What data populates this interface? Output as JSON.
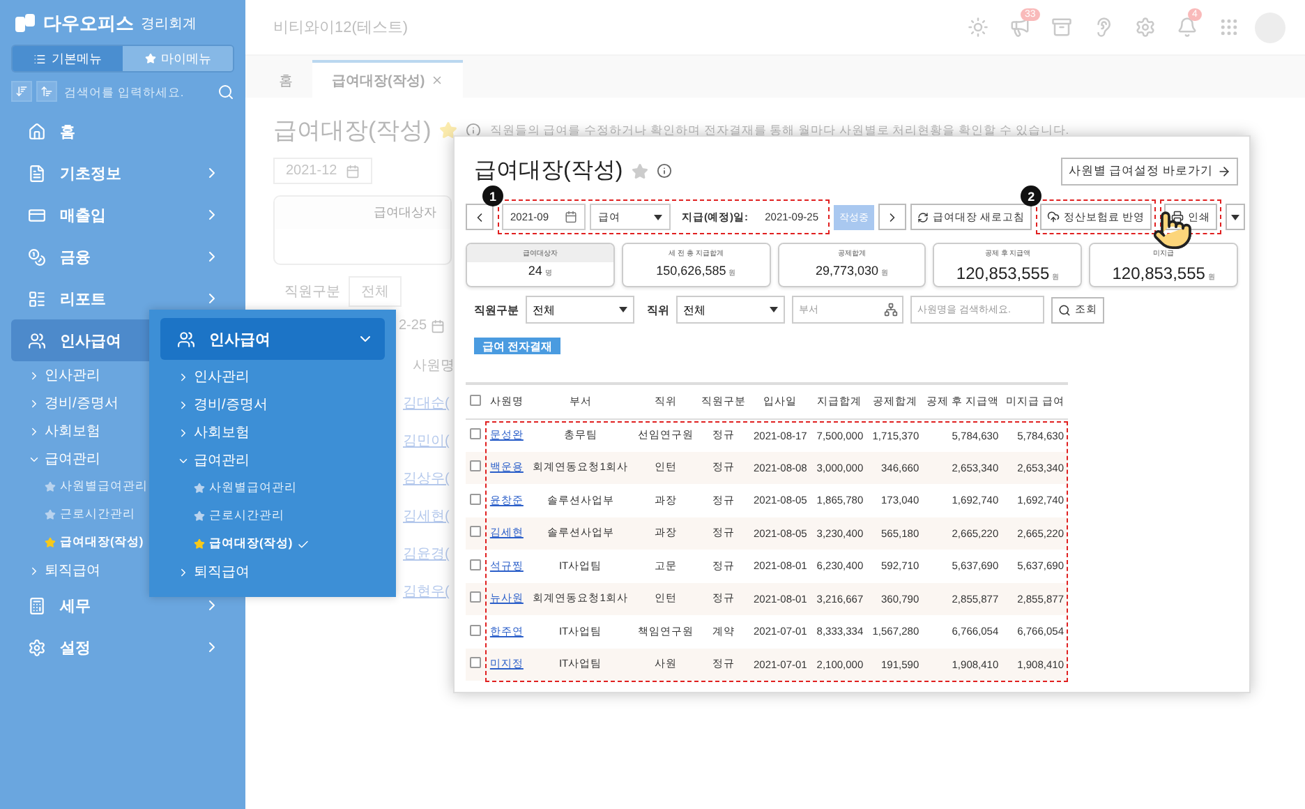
{
  "sidebar": {
    "brand": "다우오피스",
    "brand_sub": "경리회계",
    "menu_toggle": [
      {
        "label": "기본메뉴",
        "selected": true
      },
      {
        "label": "마이메뉴",
        "selected": false
      }
    ],
    "search": {
      "placeholder": "검색어를 입력하세요."
    },
    "items": [
      {
        "label": "홈",
        "has_submenu": false,
        "selected": false
      },
      {
        "label": "기초정보",
        "has_submenu": true,
        "selected": false,
        "expanded": false
      },
      {
        "label": "매출입",
        "has_submenu": true,
        "selected": false,
        "expanded": false
      },
      {
        "label": "금융",
        "has_submenu": true,
        "selected": false,
        "expanded": false
      },
      {
        "label": "리포트",
        "has_submenu": true,
        "selected": false,
        "expanded": false
      },
      {
        "label": "인사급여",
        "has_submenu": true,
        "selected": true,
        "expanded": true,
        "children": [
          {
            "label": "인사관리",
            "expanded": false
          },
          {
            "label": "경비/증명서",
            "expanded": false
          },
          {
            "label": "사회보험",
            "expanded": false
          },
          {
            "label": "급여관리",
            "expanded": true,
            "children": [
              {
                "label": "사원별급여관리",
                "selected": false
              },
              {
                "label": "근로시간관리",
                "selected": false
              },
              {
                "label": "급여대장(작성)",
                "selected": true
              }
            ]
          },
          {
            "label": "퇴직급여",
            "expanded": false
          }
        ]
      },
      {
        "label": "세무",
        "has_submenu": true,
        "selected": false,
        "expanded": false
      },
      {
        "label": "설정",
        "has_submenu": true,
        "selected": false,
        "expanded": false
      }
    ]
  },
  "popup_menu": {
    "title": "인사급여",
    "expanded": true,
    "children": [
      {
        "label": "인사관리",
        "expanded": false
      },
      {
        "label": "경비/증명서",
        "expanded": false
      },
      {
        "label": "사회보험",
        "expanded": false
      },
      {
        "label": "급여관리",
        "expanded": true,
        "children": [
          {
            "label": "사원별급여관리",
            "selected": false
          },
          {
            "label": "근로시간관리",
            "selected": false
          },
          {
            "label": "급여대장(작성)",
            "selected": true
          }
        ]
      },
      {
        "label": "퇴직급여",
        "expanded": false
      }
    ]
  },
  "topbar": {
    "company": "비티와이12(테스트)",
    "icons": [
      {
        "kind": "sun"
      },
      {
        "kind": "megaphone",
        "badge": "33"
      },
      {
        "kind": "drawer"
      },
      {
        "kind": "ear"
      },
      {
        "kind": "gear"
      },
      {
        "kind": "bell",
        "badge": "4"
      },
      {
        "kind": "apps"
      },
      {
        "kind": "avatar"
      }
    ]
  },
  "tabs": [
    {
      "label": "홈",
      "selected": false,
      "closable": false
    },
    {
      "label": "급여대장(작성)",
      "selected": true,
      "closable": true
    }
  ],
  "background_page": {
    "title": "급여대장(작성)",
    "description": "직원들의 급여를 수정하거나 확인하며 전자결재를 통해 월마다 사원별로 처리현황을 확인할 수 있습니다.",
    "period": "2021-12",
    "summary_label": "급여대상자",
    "filter_label": "직원구분",
    "filter_value": "전체",
    "date_fragment": "2-25",
    "column": "사원명",
    "names": [
      "김대순(",
      "김민이(",
      "김상우(",
      "김세현(",
      "김윤경(",
      "김현우("
    ]
  },
  "card": {
    "title": "급여대장(작성)",
    "shortcut_button": "사원별 급여설정 바로가기",
    "callouts": [
      {
        "number": "1"
      },
      {
        "number": "2"
      }
    ],
    "period": "2021-09",
    "pay_type": "급여",
    "pay_date_label": "지급(예정)일:",
    "pay_date": "2021-09-25",
    "status": "작성중",
    "refresh_button": "급여대장 새로고침",
    "insurance_button": "정산보험료 반영",
    "print_button": "인쇄",
    "summary": [
      {
        "label": "급여대상자",
        "value": "24",
        "unit": "명",
        "selected": true
      },
      {
        "label": "세 전 총 지급합계",
        "value": "150,626,585",
        "unit": "원",
        "selected": false
      },
      {
        "label": "공제합계",
        "value": "29,773,030",
        "unit": "원",
        "selected": false
      },
      {
        "label": "공제 후 지급액",
        "value": "120,853,555",
        "unit": "원",
        "selected": false
      },
      {
        "label": "미지급",
        "value": "120,853,555",
        "unit": "원",
        "selected": false
      }
    ],
    "filters": {
      "type_label": "직원구분",
      "type_value": "전체",
      "position_label": "직위",
      "position_value": "전체",
      "dept_placeholder": "부서",
      "name_placeholder": "사원명을 검색하세요.",
      "search_button": "조회"
    },
    "approval_button": "급여 전자결재",
    "table": {
      "select_all": {
        "checked": false
      },
      "columns": [
        "사원명",
        "부서",
        "직위",
        "직원구분",
        "입사일",
        "지급합계",
        "공제합계",
        "공제 후 지급액",
        "미지급 급여"
      ],
      "rows": [
        {
          "checked": false,
          "cells": [
            "문성완",
            "총무팀",
            "선임연구원",
            "정규",
            "2021-08-17",
            "7,500,000",
            "1,715,370",
            "5,784,630",
            "5,784,630"
          ]
        },
        {
          "checked": false,
          "cells": [
            "백운용",
            "회계연동요청1회사",
            "인턴",
            "정규",
            "2021-08-08",
            "3,000,000",
            "346,660",
            "2,653,340",
            "2,653,340"
          ]
        },
        {
          "checked": false,
          "cells": [
            "윤창준",
            "솔루션사업부",
            "과장",
            "정규",
            "2021-08-05",
            "1,865,780",
            "173,040",
            "1,692,740",
            "1,692,740"
          ]
        },
        {
          "checked": false,
          "cells": [
            "김세현",
            "솔루션사업부",
            "과장",
            "정규",
            "2021-08-05",
            "3,230,400",
            "565,180",
            "2,665,220",
            "2,665,220"
          ]
        },
        {
          "checked": false,
          "cells": [
            "석규찡",
            "IT사업팀",
            "고문",
            "정규",
            "2021-08-01",
            "6,230,400",
            "592,710",
            "5,637,690",
            "5,637,690"
          ]
        },
        {
          "checked": false,
          "cells": [
            "뉴사원",
            "회계연동요청1회사",
            "인턴",
            "정규",
            "2021-08-01",
            "3,216,667",
            "360,790",
            "2,855,877",
            "2,855,877"
          ]
        },
        {
          "checked": false,
          "cells": [
            "한주연",
            "IT사업팀",
            "책임연구원",
            "계약",
            "2021-07-01",
            "8,333,334",
            "1,567,280",
            "6,766,054",
            "6,766,054"
          ]
        },
        {
          "checked": false,
          "cells": [
            "미지정",
            "IT사업팀",
            "사원",
            "정규",
            "2021-07-01",
            "2,100,000",
            "191,590",
            "1,908,410",
            "1,908,410"
          ]
        }
      ]
    }
  }
}
